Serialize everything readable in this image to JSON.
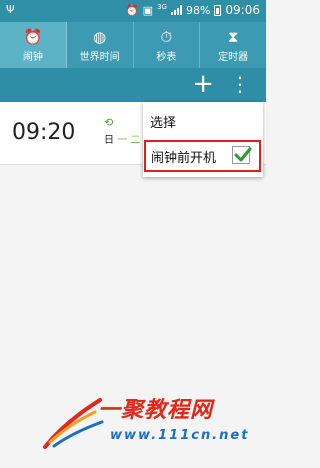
{
  "status_bar": {
    "network": "3G",
    "battery": "98%",
    "time": "09:06"
  },
  "tabs": [
    {
      "label": "闹钟",
      "icon": "alarm-clock-icon",
      "active": true
    },
    {
      "label": "世界时间",
      "icon": "globe-icon",
      "active": false
    },
    {
      "label": "秒表",
      "icon": "stopwatch-icon",
      "active": false
    },
    {
      "label": "定时器",
      "icon": "hourglass-icon",
      "active": false
    }
  ],
  "actionbar": {
    "add_label": "+",
    "more_label": "⋮"
  },
  "alarm": {
    "time": "09:20",
    "repeat_icon": "repeat-icon",
    "days_prefix": "日",
    "days_marks": "一 二"
  },
  "menu": {
    "select": "选择",
    "power_on": "闹钟前开机",
    "power_on_checked": true
  },
  "watermark": {
    "title": "一聚教程网",
    "url": "www.111cn.net"
  },
  "colors": {
    "status_bar": "#2f8fa6",
    "tabbar": "#3c9bb3",
    "active_tab": "#5cb3c6",
    "highlight": "#e41e1e",
    "check": "#2e9a3a"
  }
}
